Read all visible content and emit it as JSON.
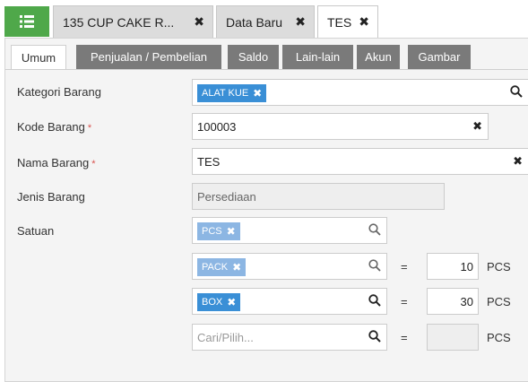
{
  "tabs": [
    {
      "label": "135 CUP CAKE R..."
    },
    {
      "label": "Data Baru"
    },
    {
      "label": "TES"
    }
  ],
  "subtabs": [
    "Umum",
    "Penjualan / Pembelian",
    "Saldo",
    "Lain-lain",
    "Akun",
    "Gambar"
  ],
  "form": {
    "kategori": {
      "label": "Kategori Barang",
      "chip": "ALAT KUE"
    },
    "kode": {
      "label": "Kode Barang",
      "required": "*",
      "value": "100003"
    },
    "nama": {
      "label": "Nama Barang",
      "required": "*",
      "value": "TES"
    },
    "jenis": {
      "label": "Jenis Barang",
      "value": "Persediaan"
    },
    "satuan": {
      "label": "Satuan",
      "rows": [
        {
          "chip": "PCS"
        },
        {
          "chip": "PACK",
          "equals": "=",
          "qty": "10",
          "unit": "PCS"
        },
        {
          "chip": "BOX",
          "equals": "=",
          "qty": "30",
          "unit": "PCS"
        },
        {
          "placeholder": "Cari/Pilih...",
          "equals": "=",
          "qty": "",
          "unit": "PCS"
        }
      ]
    }
  },
  "colors": {
    "accent": "#4fa84a",
    "chip": "#3a8fd6",
    "chip_light": "#8cb6e3",
    "subtab": "#7a7a7a",
    "required": "#d9534f"
  }
}
